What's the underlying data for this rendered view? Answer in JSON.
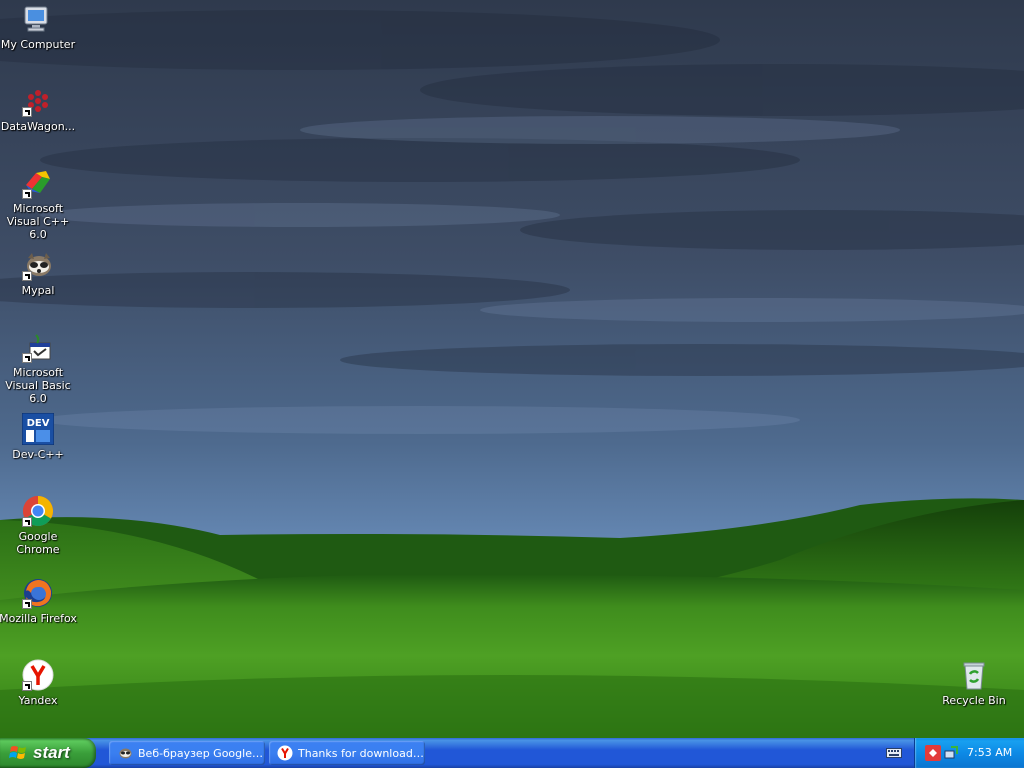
{
  "desktop": {
    "icons": [
      {
        "label": "My Computer",
        "icon": "my-computer-icon"
      },
      {
        "label": "DataWagon...",
        "icon": "datawagon-icon"
      },
      {
        "label": "Microsoft Visual C++ 6.0",
        "icon": "visual-cpp-icon"
      },
      {
        "label": "Mypal",
        "icon": "mypal-icon"
      },
      {
        "label": "Microsoft Visual Basic 6.0",
        "icon": "visual-basic-icon"
      },
      {
        "label": "Dev-C++",
        "icon": "devcpp-icon"
      },
      {
        "label": "Google Chrome",
        "icon": "chrome-icon"
      },
      {
        "label": "Mozilla Firefox",
        "icon": "firefox-icon"
      },
      {
        "label": "Yandex",
        "icon": "yandex-icon"
      },
      {
        "label": "Recycle Bin",
        "icon": "recycle-bin-icon"
      }
    ]
  },
  "taskbar": {
    "start_label": "start",
    "tasks": [
      {
        "label": "Веб-браузер Google ...",
        "icon": "mypal-icon"
      },
      {
        "label": "Thanks for downloadi...",
        "icon": "yandex-icon"
      }
    ],
    "clock": "7:53 AM"
  },
  "colors": {
    "taskbar": "#2157d7",
    "start_button": "#3a9f3a",
    "tray": "#0d8ae6"
  }
}
